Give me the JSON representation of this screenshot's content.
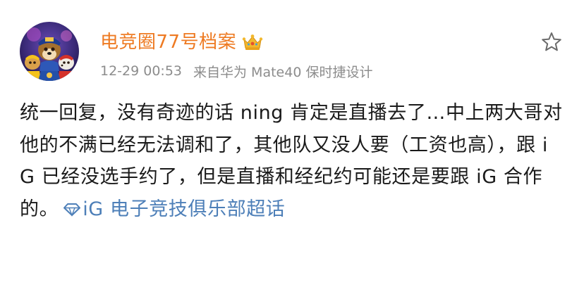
{
  "post": {
    "author": {
      "name": "电竞圈77号档案",
      "badge_icon": "crown-icon"
    },
    "time": "12-29 00:53",
    "source": "来自华为 Mate40 保时捷设计",
    "text": "统一回复，没有奇迹的话 ning 肯定是直播去了…中上两大哥对他的不满已经无法调和了，其他队又没人要（工资也高），跟 iG 已经没选手约了，但是直播和经纪约可能还是要跟 iG 合作的。",
    "topic": {
      "icon": "diamond-icon",
      "label": "iG 电子竞技俱乐部超话"
    },
    "favorite_icon": "star-icon"
  },
  "colors": {
    "username": "#ee7a22",
    "meta": "#8c8c8c",
    "text": "#1a1a1a",
    "link": "#4d7fb8",
    "crown": "#f2b82e"
  }
}
